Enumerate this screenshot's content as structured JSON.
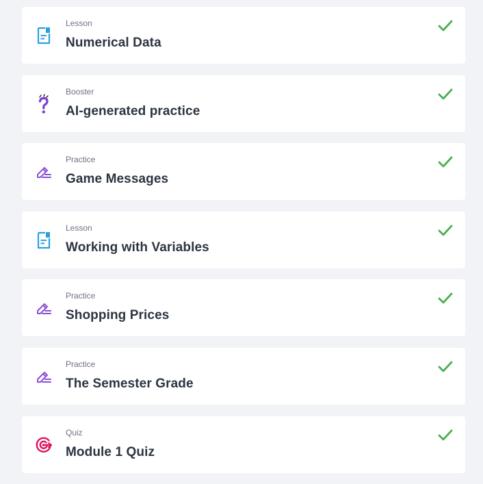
{
  "items": [
    {
      "type": "Lesson",
      "title": "Numerical Data",
      "icon": "lesson-doc-icon",
      "completed": true
    },
    {
      "type": "Booster",
      "title": "AI-generated practice",
      "icon": "question-mark-icon",
      "completed": true
    },
    {
      "type": "Practice",
      "title": "Game Messages",
      "icon": "pencil-icon",
      "completed": true
    },
    {
      "type": "Lesson",
      "title": "Working with Variables",
      "icon": "lesson-doc-icon",
      "completed": true
    },
    {
      "type": "Practice",
      "title": "Shopping Prices",
      "icon": "pencil-icon",
      "completed": true
    },
    {
      "type": "Practice",
      "title": "The Semester Grade",
      "icon": "pencil-icon",
      "completed": true
    },
    {
      "type": "Quiz",
      "title": "Module 1 Quiz",
      "icon": "target-icon",
      "completed": true
    }
  ],
  "colors": {
    "background": "#f1f3f6",
    "card": "#ffffff",
    "lesson_icon": "#2a9fe0",
    "practice_icon": "#8a4fd8",
    "booster_icon": "#7b3fd0",
    "quiz_icon": "#e0115f",
    "check": "#4caf50",
    "title": "#2b3440",
    "type": "#6b7280"
  }
}
